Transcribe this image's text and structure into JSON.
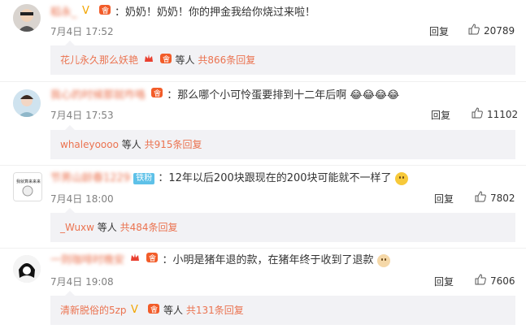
{
  "colors": {
    "accent": "#eb7350",
    "subbg": "#f2f2f5",
    "time": "#808080"
  },
  "comments": [
    {
      "username": "稻永_",
      "text": "：奶奶！奶奶！你的押金我给你烧过来啦！",
      "time": "7月4日 17:52",
      "reply_label": "回复",
      "likes": "20789",
      "sub": {
        "name": "花儿永久那么妖艳",
        "suffix": " 等人 ",
        "count": "共866条回复"
      }
    },
    {
      "username": "我心的时候那就咋咯",
      "text": "：那么哪个小可怜蛋要排到十二年后啊 😂😂😂😂",
      "time": "7月4日 17:53",
      "reply_label": "回复",
      "likes": "11102",
      "sub": {
        "name": "whaleyoooo",
        "suffix": " 等人 ",
        "count": "共915条回复"
      }
    },
    {
      "username": "节男山龄春1229",
      "fan_badge": "铁粉",
      "text": "：12年以后200块跟现在的200块可能就不一样了",
      "time": "7月4日 18:00",
      "reply_label": "回复",
      "likes": "7802",
      "sub": {
        "name": "_Wuxw",
        "suffix": " 等人 ",
        "count": "共484条回复"
      }
    },
    {
      "username": "一则咖啡时晚安",
      "text": "：小明是猪年退的款，在猪年终于收到了退款",
      "time": "7月4日 19:08",
      "reply_label": "回复",
      "likes": "7606",
      "sub": {
        "name": "清新脱俗的5zp",
        "suffix": " 等人 ",
        "count": "共131条回复"
      }
    }
  ]
}
